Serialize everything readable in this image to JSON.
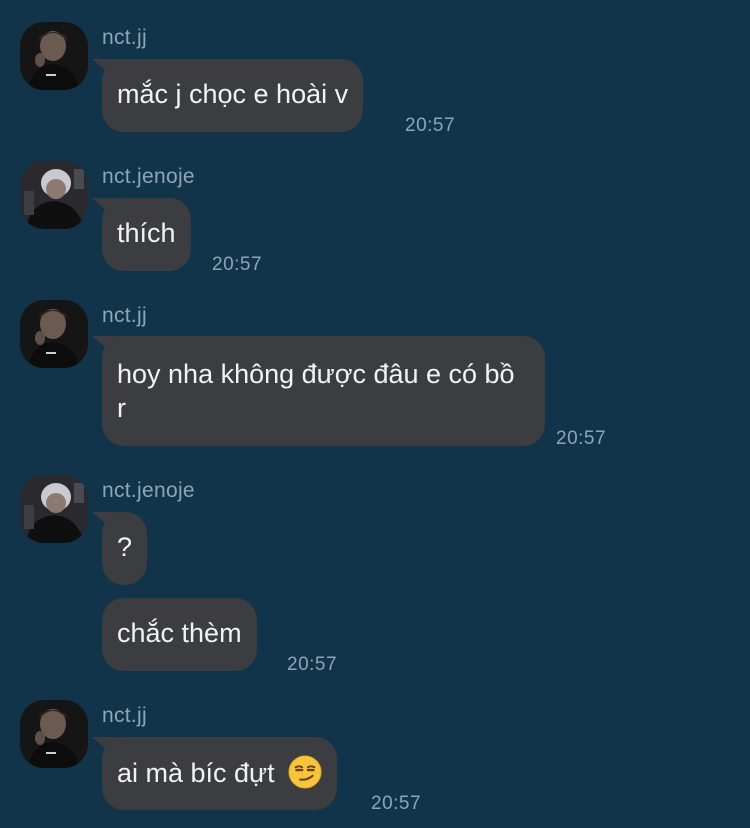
{
  "messages": [
    {
      "sender": "nct.jj",
      "text": "mắc j chọc e hoài v",
      "time": "20:57"
    },
    {
      "sender": "nct.jenoje",
      "text": "thích",
      "time": "20:57"
    },
    {
      "sender": "nct.jj",
      "text": "hoy nha không được đâu e có bồ r",
      "time": "20:57"
    },
    {
      "sender": "nct.jenoje",
      "text": "?",
      "time": ""
    },
    {
      "sender": "nct.jenoje",
      "text": "chắc thèm",
      "time": "20:57"
    },
    {
      "sender": "nct.jj",
      "text": "ai mà bíc đựt",
      "emoji": "smirking-face-emoji",
      "time": "20:57"
    }
  ],
  "colors": {
    "background": "#12344b",
    "bubble": "#3b3d41",
    "bubble_text": "#f2f2f2",
    "meta_text": "#8fa4b4"
  }
}
